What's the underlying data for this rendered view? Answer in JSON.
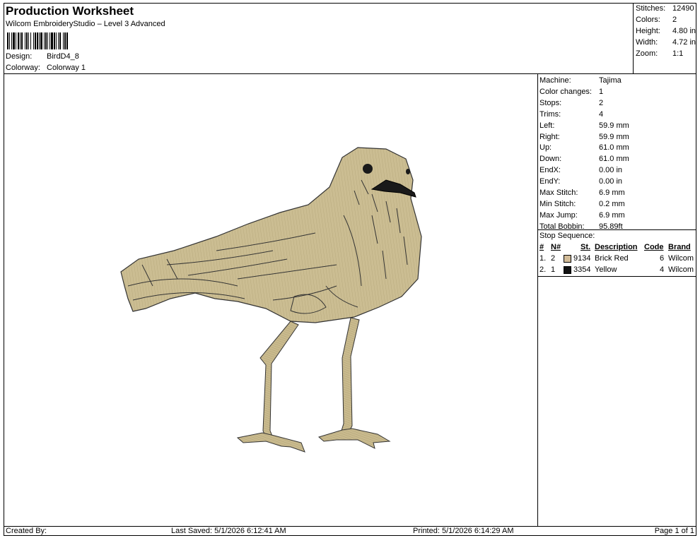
{
  "header": {
    "title": "Production Worksheet",
    "subtitle": "Wilcom EmbroideryStudio – Level 3 Advanced",
    "design_label": "Design:",
    "design_value": "BirdD4_8",
    "colorway_label": "Colorway:",
    "colorway_value": "Colorway 1"
  },
  "stats": [
    {
      "label": "Stitches:",
      "value": "12490"
    },
    {
      "label": "Colors:",
      "value": "2"
    },
    {
      "label": "Height:",
      "value": "4.80 in"
    },
    {
      "label": "Width:",
      "value": "4.72 in"
    },
    {
      "label": "Zoom:",
      "value": "1:1"
    }
  ],
  "machine_info": [
    {
      "label": "Machine:",
      "value": "Tajima"
    },
    {
      "label": "Color changes:",
      "value": "1"
    },
    {
      "label": "Stops:",
      "value": "2"
    },
    {
      "label": "Trims:",
      "value": "4"
    },
    {
      "label": "Left:",
      "value": "59.9 mm"
    },
    {
      "label": "Right:",
      "value": "59.9 mm"
    },
    {
      "label": "Up:",
      "value": "61.0 mm"
    },
    {
      "label": "Down:",
      "value": "61.0 mm"
    },
    {
      "label": "EndX:",
      "value": "0.00 in"
    },
    {
      "label": "EndY:",
      "value": "0.00 in"
    },
    {
      "label": "Max Stitch:",
      "value": "6.9 mm"
    },
    {
      "label": "Min Stitch:",
      "value": "0.2 mm"
    },
    {
      "label": "Max Jump:",
      "value": "6.9 mm"
    },
    {
      "label": "Total Bobbin:",
      "value": "95.89ft"
    }
  ],
  "stop_sequence": {
    "title": "Stop Sequence:",
    "columns": [
      "#",
      "N#",
      "St.",
      "Description",
      "Code",
      "Brand"
    ],
    "rows": [
      {
        "num": "1.",
        "n": "2",
        "color": "#d2bc98",
        "st": "9134",
        "description": "Brick Red",
        "code": "6",
        "brand": "Wilcom"
      },
      {
        "num": "2.",
        "n": "1",
        "color": "#111111",
        "st": "3354",
        "description": "Yellow",
        "code": "4",
        "brand": "Wilcom"
      }
    ]
  },
  "footer": {
    "created_by": "Created By:",
    "last_saved": "Last Saved: 5/1/2026 6:12:41 AM",
    "printed": "Printed: 5/1/2026 6:14:29 AM",
    "page": "Page 1 of 1"
  },
  "colors": {
    "thread_body": "#cbbd92",
    "thread_dark": "#1a1a1a"
  }
}
